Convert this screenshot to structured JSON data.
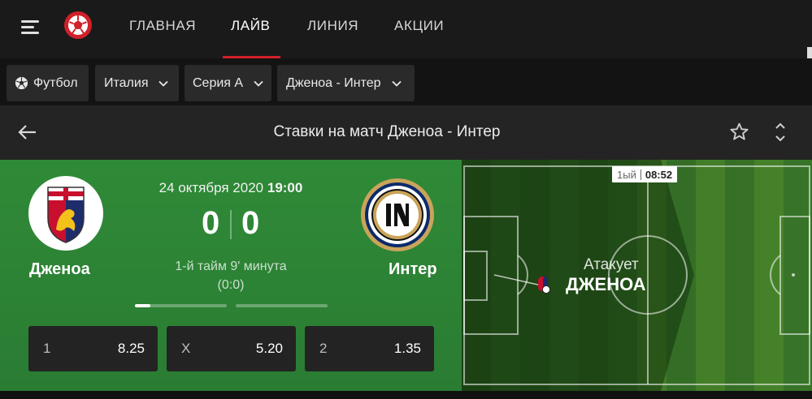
{
  "nav": {
    "items": [
      "ГЛАВНАЯ",
      "ЛАЙВ",
      "ЛИНИЯ",
      "АКЦИИ"
    ],
    "active_index": 1,
    "accent_color": "#d0202a"
  },
  "filters": {
    "sport": "Футбол",
    "country": "Италия",
    "league": "Серия А",
    "match": "Дженоа - Интер"
  },
  "header": {
    "title": "Ставки на матч Дженоа - Интер"
  },
  "match": {
    "date": "24 октября 2020",
    "time": "19:00",
    "home": {
      "name": "Дженоа",
      "score": "0"
    },
    "away": {
      "name": "Интер",
      "score": "0"
    },
    "period_text": "1-й тайм 9' минута",
    "halftime_score": "(0:0)",
    "first_half_progress": 0.17,
    "second_half_progress": 0
  },
  "odds": [
    {
      "label": "1",
      "value": "8.25"
    },
    {
      "label": "X",
      "value": "5.20"
    },
    {
      "label": "2",
      "value": "1.35"
    }
  ],
  "pitch": {
    "period": "1ый",
    "clock": "08:52",
    "attack_label": "Атакует",
    "attacking_team": "ДЖЕНОА"
  }
}
